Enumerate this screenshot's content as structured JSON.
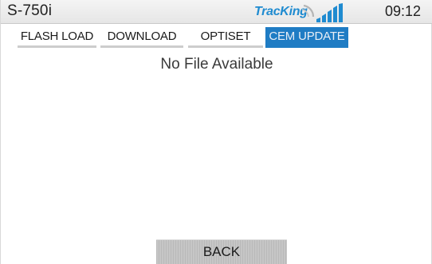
{
  "header": {
    "device_name": "S-750i",
    "logo_text": "TracKing",
    "logo_icon": "signal-bars-icon",
    "clock": "09:12"
  },
  "tabs": [
    {
      "label": "FLASH LOAD",
      "active": false
    },
    {
      "label": "DOWNLOAD",
      "active": false
    },
    {
      "label": "OPTISET",
      "active": false
    },
    {
      "label": "CEM UPDATE",
      "active": true
    }
  ],
  "main": {
    "status_message": "No File Available"
  },
  "footer": {
    "back_label": "BACK"
  },
  "colors": {
    "accent": "#1f7cc4",
    "brand": "#1f8bd0",
    "tab_underline": "#cdcdcd",
    "button_gray": "#c0c0c0"
  }
}
